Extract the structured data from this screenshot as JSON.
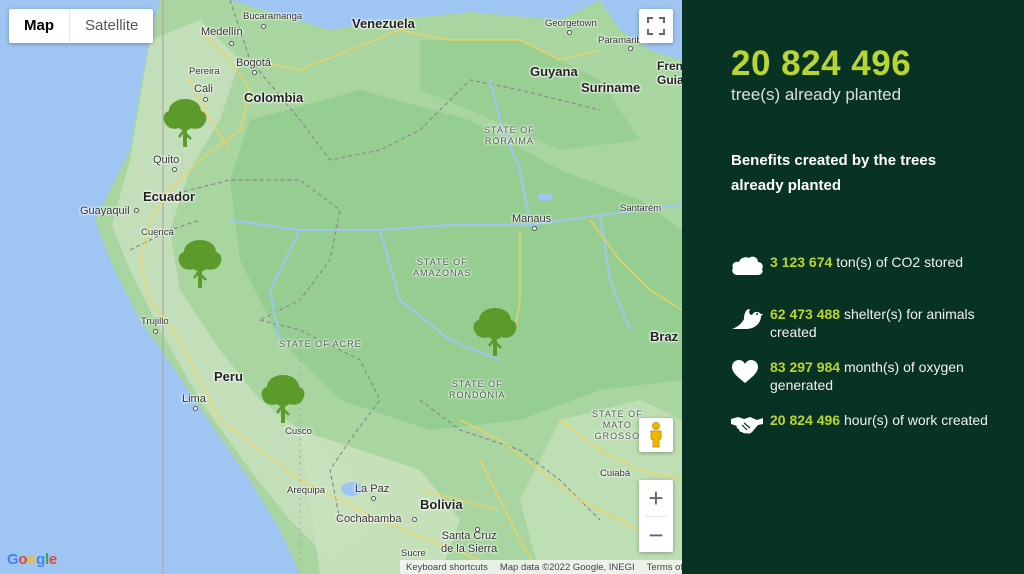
{
  "map": {
    "type_control": {
      "map_label": "Map",
      "satellite_label": "Satellite",
      "selected": "Map"
    },
    "countries": [
      "Venezuela",
      "Colombia",
      "Ecuador",
      "Peru",
      "Bolivia",
      "Guyana",
      "Suriname",
      "Brazil"
    ],
    "country_labels": {
      "venezuela": "Venezuela",
      "colombia": "Colombia",
      "ecuador": "Ecuador",
      "peru": "Peru",
      "bolivia": "Bolivia",
      "guyana": "Guyana",
      "suriname": "Suriname",
      "brazil": "Braz",
      "french_guiana": "Fren\nGuia"
    },
    "cities": {
      "bucaramanga": "Bucaramanga",
      "medellin": "Medellín",
      "bogota": "Bogotá",
      "pereira": "Pereira",
      "cali": "Cali",
      "quito": "Quito",
      "guayaquil": "Guayaquil",
      "cuenca": "Cuenca",
      "trujillo": "Trujillo",
      "lima": "Lima",
      "cusco": "Cusco",
      "arequipa": "Arequipa",
      "la_paz": "La Paz",
      "cochabamba": "Cochabamba",
      "sucre": "Sucre",
      "santa_cruz": "Santa Cruz\nde la Sierra",
      "manaus": "Manaus",
      "santarem": "Santarém",
      "georgetown": "Georgetown",
      "paramaribo": "Paramaribo",
      "cuiaba": "Cuiabá"
    },
    "states": {
      "roraima": "STATE OF\nRORAIMA",
      "amazonas": "STATE OF\nAMAZONAS",
      "acre": "STATE OF ACRE",
      "rondonia": "STATE OF\nRONDÔNIA",
      "mato_grosso": "STATE OF\nMATO\nGROSSO"
    },
    "markers": [
      {
        "name": "tree-marker",
        "icon": "tree-icon"
      },
      {
        "name": "tree-marker",
        "icon": "tree-icon"
      },
      {
        "name": "tree-marker",
        "icon": "tree-icon"
      },
      {
        "name": "tree-marker",
        "icon": "tree-icon"
      }
    ],
    "zoom_in_label": "+",
    "zoom_out_label": "−",
    "google_logo": "Google",
    "attribution": {
      "shortcuts": "Keyboard shortcuts",
      "data": "Map data ©2022 Google, INEGI",
      "terms": "Terms of Use"
    },
    "colors": {
      "land": "#a8d5a0",
      "forest": "#8ecb8a",
      "water": "#9fc6f3",
      "roads": "#f7d25c",
      "marker": "#5c9b2b"
    }
  },
  "panel": {
    "tree_count": "20 824 496",
    "tree_label": "tree(s) already planted",
    "benefits_title": "Benefits created by the trees already planted",
    "stats": [
      {
        "icon": "cloud-icon",
        "value": "3 123 674",
        "text": "ton(s) of CO2 stored"
      },
      {
        "icon": "bird-icon",
        "value": "62 473 488",
        "text": "shelter(s) for animals created"
      },
      {
        "icon": "heart-icon",
        "value": "83 297 984",
        "text": "month(s) of oxygen generated"
      },
      {
        "icon": "handshake-icon",
        "value": "20 824 496",
        "text": "hour(s) of work created"
      }
    ],
    "colors": {
      "background": "#083324",
      "accent": "#b9d630",
      "text": "#ffffff"
    }
  }
}
